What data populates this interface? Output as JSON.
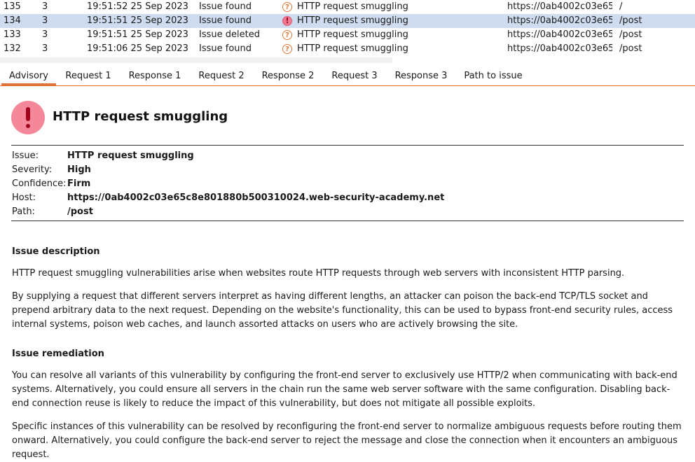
{
  "colors": {
    "accent": "#e0733a",
    "selected_row": "#cfdcf0",
    "severity_high": "#f4889a"
  },
  "issues_table": {
    "rows": [
      {
        "id": "135",
        "n": "3",
        "time": "19:51:52 25 Sep 2023",
        "action": "Issue found",
        "icon": "question-circle-icon",
        "issue": "HTTP request smuggling",
        "host": "https://0ab4002c03e65c...",
        "path": "/"
      },
      {
        "id": "134",
        "n": "3",
        "time": "19:51:51 25 Sep 2023",
        "action": "Issue found",
        "icon": "high-severity-icon",
        "issue": "HTTP request smuggling",
        "host": "https://0ab4002c03e65c...",
        "path": "/post"
      },
      {
        "id": "133",
        "n": "3",
        "time": "19:51:51 25 Sep 2023",
        "action": "Issue deleted",
        "icon": "question-circle-icon",
        "issue": "HTTP request smuggling",
        "host": "https://0ab4002c03e65c...",
        "path": "/post"
      },
      {
        "id": "132",
        "n": "3",
        "time": "19:51:06 25 Sep 2023",
        "action": "Issue found",
        "icon": "question-circle-icon",
        "issue": "HTTP request smuggling",
        "host": "https://0ab4002c03e65c...",
        "path": "/post"
      }
    ]
  },
  "tabs": [
    "Advisory",
    "Request 1",
    "Response 1",
    "Request 2",
    "Response 2",
    "Request 3",
    "Response 3",
    "Path to issue"
  ],
  "advisory": {
    "title": "HTTP request smuggling",
    "fields": {
      "issue_label": "Issue:",
      "issue_value": "HTTP request smuggling",
      "severity_label": "Severity:",
      "severity_value": "High",
      "confidence_label": "Confidence:",
      "confidence_value": "Firm",
      "host_label": "Host:",
      "host_value": "https://0ab4002c03e65c8e801880b500310024.web-security-academy.net",
      "path_label": "Path:",
      "path_value": "/post"
    },
    "description_heading": "Issue description",
    "description_p1": "HTTP request smuggling vulnerabilities arise when websites route HTTP requests through web servers with inconsistent HTTP parsing.",
    "description_p2": "By supplying a request that different servers interpret as having different lengths, an attacker can poison the back-end TCP/TLS socket and prepend arbitrary data to the next request. Depending on the website's functionality, this can be used to bypass front-end security rules, access internal systems, poison web caches, and launch assorted attacks on users who are actively browsing the site.",
    "remediation_heading": "Issue remediation",
    "remediation_p1": "You can resolve all variants of this vulnerability by configuring the front-end server to exclusively use HTTP/2 when communicating with back-end systems. Alternatively, you could ensure all servers in the chain run the same web server software with the same configuration. Disabling back-end connection reuse is likely to reduce the impact of this vulnerability, but does not mitigate all possible exploits.",
    "remediation_p2": "Specific instances of this vulnerability can be resolved by reconfiguring the front-end server to normalize ambiguous requests before routing them onward. Alternatively, you could configure the back-end server to reject the message and close the connection when it encounters an ambiguous request."
  }
}
